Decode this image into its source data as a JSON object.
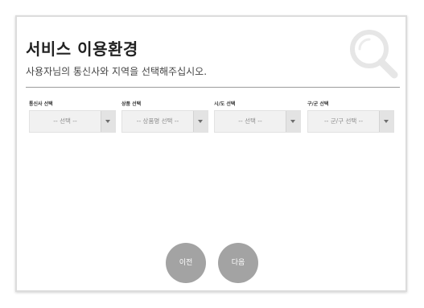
{
  "header": {
    "title": "서비스 이용환경",
    "subtitle": "사용자님의 통신사와 지역을 선택해주십시오."
  },
  "selects": [
    {
      "label": "통신사 선택",
      "value": "-- 선택 --"
    },
    {
      "label": "상품 선택",
      "value": "-- 상품명 선택 --"
    },
    {
      "label": "시/도 선택",
      "value": "-- 선택 --"
    },
    {
      "label": "구/군 선택",
      "value": "-- 군/구 선택 --"
    }
  ],
  "buttons": {
    "prev_label": "이전",
    "next_label": "다음"
  },
  "icons": {
    "decorative": "search-icon",
    "dropdown": "chevron-down-icon"
  },
  "colors": {
    "button_bg": "#a3a3a3",
    "select_bg": "#f1f1f1",
    "divider": "#9c9c9c"
  }
}
